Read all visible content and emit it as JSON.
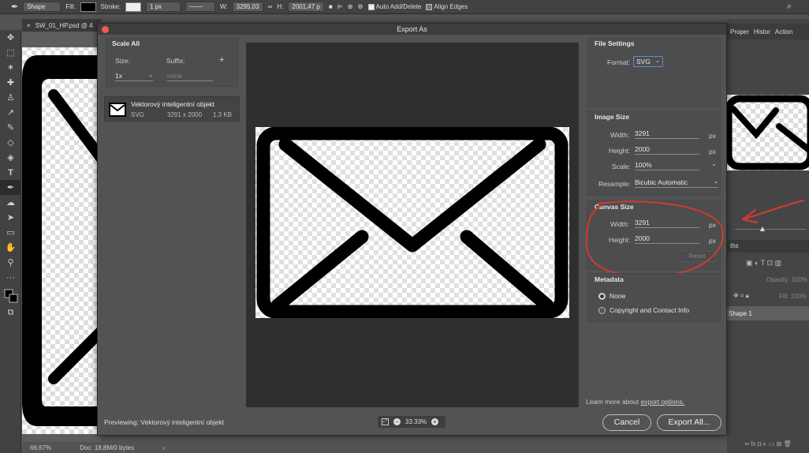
{
  "options_bar": {
    "mode": "Shape",
    "fill_label": "Fill:",
    "stroke_label": "Stroke:",
    "stroke_width": "1 px",
    "w_label": "W:",
    "w_value": "3295,03",
    "h_label": "H:",
    "h_value": "2001,47 p",
    "auto_add_delete": "Auto Add/Delete",
    "align_edges": "Align Edges"
  },
  "document": {
    "tab_title": "SW_01_HP.psd @ 4",
    "zoom": "66,67%",
    "doc_info": "Doc: 18,8M/0 bytes"
  },
  "right_panel": {
    "tabs": [
      "Proper",
      "Histor",
      "Action"
    ],
    "paths_tab": "ths",
    "opacity_label": "Opacity:",
    "opacity_value": "100%",
    "fill_label": "Fill:",
    "fill_value": "100%",
    "layer_name": "Shape 1"
  },
  "dialog": {
    "title": "Export As",
    "scale_all": {
      "heading": "Scale All",
      "size_label": "Size:",
      "suffix_label": "Suffix:",
      "size_value": "1x",
      "suffix_placeholder": "none",
      "add": "+"
    },
    "asset": {
      "name": "Vektorový inteligentní objekt",
      "format": "SVG",
      "dimensions": "3291 x 2000",
      "filesize": "1.3 KB"
    },
    "previewing": "Previewing: Vektorový inteligentní objekt",
    "zoom": "33.33%",
    "file_settings": {
      "heading": "File Settings",
      "format_label": "Format:",
      "format_value": "SVG"
    },
    "image_size": {
      "heading": "Image Size",
      "width_label": "Width:",
      "width_value": "3291",
      "height_label": "Height:",
      "height_value": "2000",
      "scale_label": "Scale:",
      "scale_value": "100%",
      "resample_label": "Resample:",
      "resample_value": "Bicubic Automatic",
      "unit": "px"
    },
    "canvas_size": {
      "heading": "Canvas Size",
      "width_label": "Width:",
      "width_value": "3291",
      "height_label": "Height:",
      "height_value": "2000",
      "unit": "px",
      "reset": "Reset"
    },
    "metadata": {
      "heading": "Metadata",
      "options": [
        "None",
        "Copyright and Contact Info"
      ],
      "selected": "None"
    },
    "learn_more_prefix": "Learn more about",
    "learn_more_link": "export options.",
    "cancel": "Cancel",
    "export_all": "Export All..."
  },
  "colors": {
    "annotation": "#d23a32",
    "close_button": "#ee5a52",
    "accent_border": "#5a8fd6"
  }
}
